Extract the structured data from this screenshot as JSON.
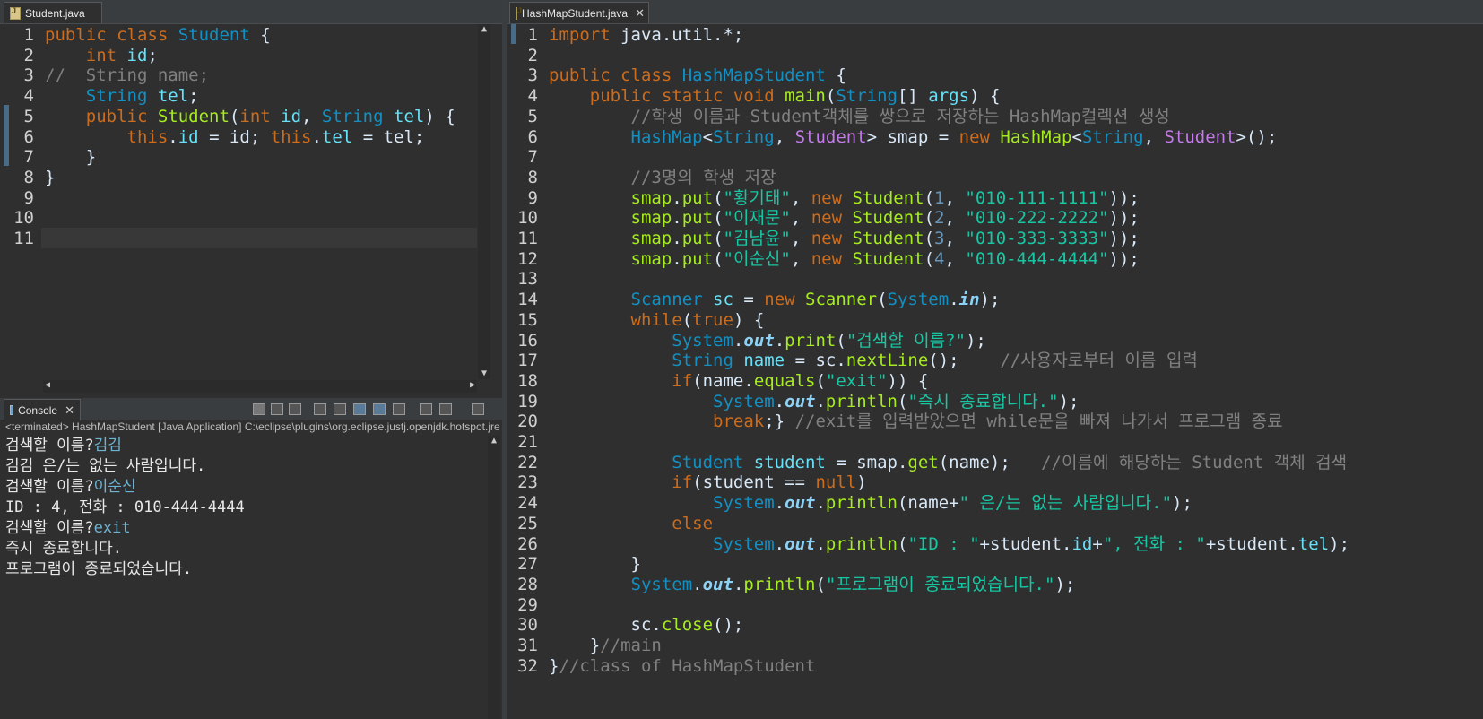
{
  "left_editor": {
    "tab_label": "Student.java",
    "lines": [
      {
        "n": "1",
        "segs": [
          [
            "kw",
            "public class "
          ],
          [
            "ty",
            "Student"
          ],
          [
            "pl",
            " {"
          ]
        ]
      },
      {
        "n": "2",
        "segs": [
          [
            "pl",
            "    "
          ],
          [
            "kw",
            "int "
          ],
          [
            "fd",
            "id"
          ],
          [
            "pl",
            ";"
          ]
        ]
      },
      {
        "n": "3",
        "segs": [
          [
            "cm",
            "//  String name;"
          ]
        ]
      },
      {
        "n": "4",
        "segs": [
          [
            "pl",
            "    "
          ],
          [
            "ty",
            "String "
          ],
          [
            "fd",
            "tel"
          ],
          [
            "pl",
            ";"
          ]
        ]
      },
      {
        "n": "5",
        "segs": [
          [
            "pl",
            "    "
          ],
          [
            "kw",
            "public "
          ],
          [
            "cl",
            "Student"
          ],
          [
            "pl",
            "("
          ],
          [
            "kw",
            "int "
          ],
          [
            "fd",
            "id"
          ],
          [
            "pl",
            ", "
          ],
          [
            "ty",
            "String "
          ],
          [
            "fd",
            "tel"
          ],
          [
            "pl",
            ") {"
          ]
        ]
      },
      {
        "n": "6",
        "segs": [
          [
            "pl",
            "        "
          ],
          [
            "kw",
            "this"
          ],
          [
            "pl",
            "."
          ],
          [
            "fd",
            "id"
          ],
          [
            "pl",
            " = id; "
          ],
          [
            "kw",
            "this"
          ],
          [
            "pl",
            "."
          ],
          [
            "fd",
            "tel"
          ],
          [
            "pl",
            " = tel;"
          ]
        ]
      },
      {
        "n": "7",
        "segs": [
          [
            "pl",
            "    }"
          ]
        ]
      },
      {
        "n": "8",
        "segs": [
          [
            "pl",
            "}"
          ]
        ]
      },
      {
        "n": "9",
        "segs": []
      },
      {
        "n": "10",
        "segs": []
      },
      {
        "n": "11",
        "segs": []
      }
    ]
  },
  "right_editor": {
    "tab_label": "HashMapStudent.java",
    "lines": [
      {
        "n": "1",
        "segs": [
          [
            "kw",
            "import "
          ],
          [
            "pl",
            "java.util.*;"
          ]
        ]
      },
      {
        "n": "2",
        "segs": []
      },
      {
        "n": "3",
        "segs": [
          [
            "kw",
            "public class "
          ],
          [
            "ty",
            "HashMapStudent"
          ],
          [
            "pl",
            " {"
          ]
        ]
      },
      {
        "n": "4",
        "segs": [
          [
            "pl",
            "    "
          ],
          [
            "kw",
            "public static void "
          ],
          [
            "cl",
            "main"
          ],
          [
            "pl",
            "("
          ],
          [
            "ty",
            "String"
          ],
          [
            "pl",
            "[] "
          ],
          [
            "fd",
            "args"
          ],
          [
            "pl",
            ") {"
          ]
        ]
      },
      {
        "n": "5",
        "segs": [
          [
            "pl",
            "        "
          ],
          [
            "cm",
            "//학생 이름과 Student객체를 쌍으로 저장하는 HashMap컬렉션 생성"
          ]
        ]
      },
      {
        "n": "6",
        "segs": [
          [
            "pl",
            "        "
          ],
          [
            "ty",
            "HashMap"
          ],
          [
            "pl",
            "<"
          ],
          [
            "ty",
            "String"
          ],
          [
            "pl",
            ", "
          ],
          [
            "gen",
            "Student"
          ],
          [
            "pl",
            "> "
          ],
          [
            "pl",
            "smap = "
          ],
          [
            "kw",
            "new "
          ],
          [
            "cl",
            "HashMap"
          ],
          [
            "pl",
            "<"
          ],
          [
            "ty",
            "String"
          ],
          [
            "pl",
            ", "
          ],
          [
            "gen",
            "Student"
          ],
          [
            "pl",
            ">();"
          ]
        ]
      },
      {
        "n": "7",
        "segs": []
      },
      {
        "n": "8",
        "segs": [
          [
            "pl",
            "        "
          ],
          [
            "cm",
            "//3명의 학생 저장"
          ]
        ]
      },
      {
        "n": "9",
        "segs": [
          [
            "pl",
            "        "
          ],
          [
            "cl",
            "smap"
          ],
          [
            "pl",
            "."
          ],
          [
            "cl",
            "put"
          ],
          [
            "pl",
            "("
          ],
          [
            "st",
            "\"황기태\""
          ],
          [
            "pl",
            ", "
          ],
          [
            "kw",
            "new "
          ],
          [
            "cl",
            "Student"
          ],
          [
            "pl",
            "("
          ],
          [
            "num",
            "1"
          ],
          [
            "pl",
            ", "
          ],
          [
            "st",
            "\"010-111-1111\""
          ],
          [
            "pl",
            "));"
          ]
        ]
      },
      {
        "n": "10",
        "segs": [
          [
            "pl",
            "        "
          ],
          [
            "cl",
            "smap"
          ],
          [
            "pl",
            "."
          ],
          [
            "cl",
            "put"
          ],
          [
            "pl",
            "("
          ],
          [
            "st",
            "\"이재문\""
          ],
          [
            "pl",
            ", "
          ],
          [
            "kw",
            "new "
          ],
          [
            "cl",
            "Student"
          ],
          [
            "pl",
            "("
          ],
          [
            "num",
            "2"
          ],
          [
            "pl",
            ", "
          ],
          [
            "st",
            "\"010-222-2222\""
          ],
          [
            "pl",
            "));"
          ]
        ]
      },
      {
        "n": "11",
        "segs": [
          [
            "pl",
            "        "
          ],
          [
            "cl",
            "smap"
          ],
          [
            "pl",
            "."
          ],
          [
            "cl",
            "put"
          ],
          [
            "pl",
            "("
          ],
          [
            "st",
            "\"김남윤\""
          ],
          [
            "pl",
            ", "
          ],
          [
            "kw",
            "new "
          ],
          [
            "cl",
            "Student"
          ],
          [
            "pl",
            "("
          ],
          [
            "num",
            "3"
          ],
          [
            "pl",
            ", "
          ],
          [
            "st",
            "\"010-333-3333\""
          ],
          [
            "pl",
            "));"
          ]
        ]
      },
      {
        "n": "12",
        "segs": [
          [
            "pl",
            "        "
          ],
          [
            "cl",
            "smap"
          ],
          [
            "pl",
            "."
          ],
          [
            "cl",
            "put"
          ],
          [
            "pl",
            "("
          ],
          [
            "st",
            "\"이순신\""
          ],
          [
            "pl",
            ", "
          ],
          [
            "kw",
            "new "
          ],
          [
            "cl",
            "Student"
          ],
          [
            "pl",
            "("
          ],
          [
            "num",
            "4"
          ],
          [
            "pl",
            ", "
          ],
          [
            "st",
            "\"010-444-4444\""
          ],
          [
            "pl",
            "));"
          ]
        ]
      },
      {
        "n": "13",
        "segs": []
      },
      {
        "n": "14",
        "segs": [
          [
            "pl",
            "        "
          ],
          [
            "ty",
            "Scanner "
          ],
          [
            "fd",
            "sc"
          ],
          [
            "pl",
            " = "
          ],
          [
            "kw",
            "new "
          ],
          [
            "cl",
            "Scanner"
          ],
          [
            "pl",
            "("
          ],
          [
            "ty",
            "System"
          ],
          [
            "pl",
            "."
          ],
          [
            "it",
            "in"
          ],
          [
            "pl",
            ");"
          ]
        ]
      },
      {
        "n": "15",
        "segs": [
          [
            "pl",
            "        "
          ],
          [
            "kw",
            "while"
          ],
          [
            "pl",
            "("
          ],
          [
            "kw",
            "true"
          ],
          [
            "pl",
            ") {"
          ]
        ]
      },
      {
        "n": "16",
        "segs": [
          [
            "pl",
            "            "
          ],
          [
            "ty",
            "System"
          ],
          [
            "pl",
            "."
          ],
          [
            "it",
            "out"
          ],
          [
            "pl",
            "."
          ],
          [
            "cl",
            "print"
          ],
          [
            "pl",
            "("
          ],
          [
            "st",
            "\"검색할 이름?\""
          ],
          [
            "pl",
            ");"
          ]
        ]
      },
      {
        "n": "17",
        "segs": [
          [
            "pl",
            "            "
          ],
          [
            "ty",
            "String "
          ],
          [
            "fd",
            "name"
          ],
          [
            "pl",
            " = sc."
          ],
          [
            "cl",
            "nextLine"
          ],
          [
            "pl",
            "();    "
          ],
          [
            "cm",
            "//사용자로부터 이름 입력"
          ]
        ]
      },
      {
        "n": "18",
        "segs": [
          [
            "pl",
            "            "
          ],
          [
            "kw",
            "if"
          ],
          [
            "pl",
            "(name."
          ],
          [
            "cl",
            "equals"
          ],
          [
            "pl",
            "("
          ],
          [
            "st",
            "\"exit\""
          ],
          [
            "pl",
            ")) {"
          ]
        ]
      },
      {
        "n": "19",
        "segs": [
          [
            "pl",
            "                "
          ],
          [
            "ty",
            "System"
          ],
          [
            "pl",
            "."
          ],
          [
            "it",
            "out"
          ],
          [
            "pl",
            "."
          ],
          [
            "cl",
            "println"
          ],
          [
            "pl",
            "("
          ],
          [
            "st",
            "\"즉시 종료합니다.\""
          ],
          [
            "pl",
            ");"
          ]
        ]
      },
      {
        "n": "20",
        "segs": [
          [
            "pl",
            "                "
          ],
          [
            "kw",
            "break"
          ],
          [
            "pl",
            ";} "
          ],
          [
            "cm",
            "//exit를 입력받았으면 while문을 빠져 나가서 프로그램 종료"
          ]
        ]
      },
      {
        "n": "21",
        "segs": []
      },
      {
        "n": "22",
        "segs": [
          [
            "pl",
            "            "
          ],
          [
            "ty",
            "Student "
          ],
          [
            "fd",
            "student"
          ],
          [
            "pl",
            " = smap."
          ],
          [
            "cl",
            "get"
          ],
          [
            "pl",
            "(name);   "
          ],
          [
            "cm",
            "//이름에 해당하는 Student 객체 검색"
          ]
        ]
      },
      {
        "n": "23",
        "segs": [
          [
            "pl",
            "            "
          ],
          [
            "kw",
            "if"
          ],
          [
            "pl",
            "(student == "
          ],
          [
            "kw",
            "null"
          ],
          [
            "pl",
            ")"
          ]
        ]
      },
      {
        "n": "24",
        "segs": [
          [
            "pl",
            "                "
          ],
          [
            "ty",
            "System"
          ],
          [
            "pl",
            "."
          ],
          [
            "it",
            "out"
          ],
          [
            "pl",
            "."
          ],
          [
            "cl",
            "println"
          ],
          [
            "pl",
            "(name+"
          ],
          [
            "st",
            "\" 은/는 없는 사람입니다.\""
          ],
          [
            "pl",
            ");"
          ]
        ]
      },
      {
        "n": "25",
        "segs": [
          [
            "pl",
            "            "
          ],
          [
            "kw",
            "else"
          ]
        ]
      },
      {
        "n": "26",
        "segs": [
          [
            "pl",
            "                "
          ],
          [
            "ty",
            "System"
          ],
          [
            "pl",
            "."
          ],
          [
            "it",
            "out"
          ],
          [
            "pl",
            "."
          ],
          [
            "cl",
            "println"
          ],
          [
            "pl",
            "("
          ],
          [
            "st",
            "\"ID : \""
          ],
          [
            "pl",
            "+student."
          ],
          [
            "fd",
            "id"
          ],
          [
            "pl",
            "+"
          ],
          [
            "st",
            "\", 전화 : \""
          ],
          [
            "pl",
            "+student."
          ],
          [
            "fd",
            "tel"
          ],
          [
            "pl",
            ");"
          ]
        ]
      },
      {
        "n": "27",
        "segs": [
          [
            "pl",
            "        }"
          ]
        ]
      },
      {
        "n": "28",
        "segs": [
          [
            "pl",
            "        "
          ],
          [
            "ty",
            "System"
          ],
          [
            "pl",
            "."
          ],
          [
            "it",
            "out"
          ],
          [
            "pl",
            "."
          ],
          [
            "cl",
            "println"
          ],
          [
            "pl",
            "("
          ],
          [
            "st",
            "\"프로그램이 종료되었습니다.\""
          ],
          [
            "pl",
            ");"
          ]
        ]
      },
      {
        "n": "29",
        "segs": []
      },
      {
        "n": "30",
        "segs": [
          [
            "pl",
            "        "
          ],
          [
            "pl",
            "sc."
          ],
          [
            "cl",
            "close"
          ],
          [
            "pl",
            "();"
          ]
        ]
      },
      {
        "n": "31",
        "segs": [
          [
            "pl",
            "    }"
          ],
          [
            "cm",
            "//main"
          ]
        ]
      },
      {
        "n": "32",
        "segs": [
          [
            "pl",
            "}"
          ],
          [
            "cm",
            "//class of HashMapStudent"
          ]
        ]
      }
    ]
  },
  "console": {
    "tab_label": "Console",
    "status": "<terminated> HashMapStudent [Java Application] C:\\eclipse\\plugins\\org.eclipse.justj.openjdk.hotspot.jre.fu",
    "output": [
      {
        "text": "검색할 이름?",
        "input": "김김"
      },
      {
        "text": "김김 은/는 없는 사람입니다.",
        "input": ""
      },
      {
        "text": "검색할 이름?",
        "input": "이순신"
      },
      {
        "text": "ID : 4, 전화 : 010-444-4444",
        "input": ""
      },
      {
        "text": "검색할 이름?",
        "input": "exit"
      },
      {
        "text": "즉시 종료합니다.",
        "input": ""
      },
      {
        "text": "프로그램이 종료되었습니다.",
        "input": ""
      }
    ]
  },
  "colors": {
    "accent": "#1290c3",
    "keyword": "#cc6c1d",
    "string": "#17c6a3",
    "comment": "#808080"
  }
}
